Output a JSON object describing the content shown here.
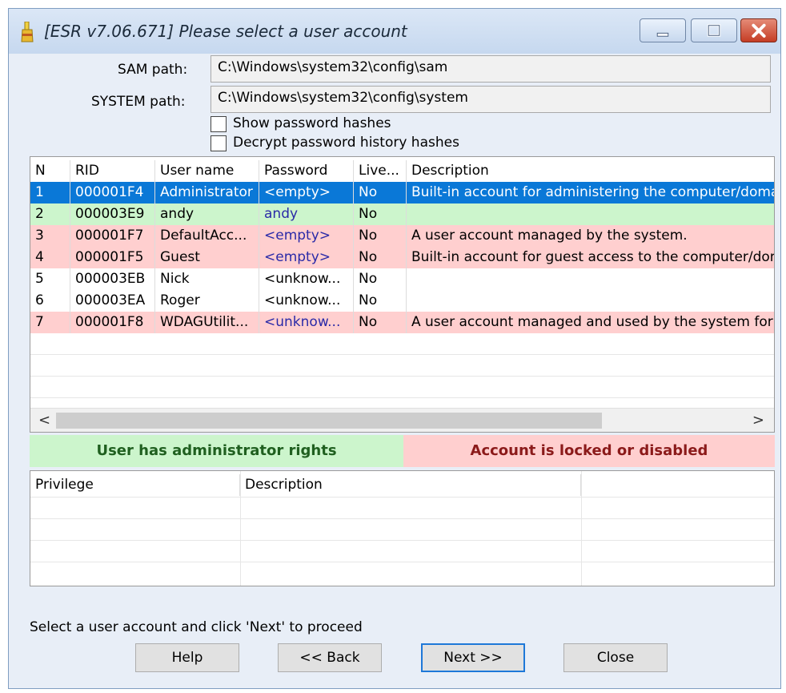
{
  "window": {
    "title": "[ESR v7.06.671]  Please select a user account",
    "icon": "brush-icon"
  },
  "paths": {
    "sam_label": "SAM path:",
    "sam_value": "C:\\Windows\\system32\\config\\sam",
    "system_label": "SYSTEM path:",
    "system_value": "C:\\Windows\\system32\\config\\system"
  },
  "options": {
    "show_hashes": "Show password hashes",
    "decrypt_history": "Decrypt password history hashes"
  },
  "accounts": {
    "columns": [
      "N",
      "RID",
      "User name",
      "Password",
      "Live...",
      "Description"
    ],
    "rows": [
      {
        "n": "1",
        "rid": "000001F4",
        "user": "Administrator",
        "password": "<empty>",
        "live": "No",
        "desc": "Built-in account for administering the computer/doma"
      },
      {
        "n": "2",
        "rid": "000003E9",
        "user": "andy",
        "password": "andy",
        "live": "No",
        "desc": ""
      },
      {
        "n": "3",
        "rid": "000001F7",
        "user": "DefaultAcc...",
        "password": "<empty>",
        "live": "No",
        "desc": "A user account managed by the system."
      },
      {
        "n": "4",
        "rid": "000001F5",
        "user": "Guest",
        "password": "<empty>",
        "live": "No",
        "desc": "Built-in account for guest access to the computer/dom"
      },
      {
        "n": "5",
        "rid": "000003EB",
        "user": "Nick",
        "password": "<unknow...",
        "live": "No",
        "desc": ""
      },
      {
        "n": "6",
        "rid": "000003EA",
        "user": "Roger",
        "password": "<unknow...",
        "live": "No",
        "desc": ""
      },
      {
        "n": "7",
        "rid": "000001F8",
        "user": "WDAGUtilit...",
        "password": "<unknow...",
        "live": "No",
        "desc": "A user account managed and used by the system for V"
      }
    ],
    "row_states": [
      "selected",
      "green",
      "red",
      "red",
      "none",
      "none",
      "red"
    ],
    "scroll_left": "<",
    "scroll_right": ">"
  },
  "legend": {
    "admin": "User has administrator rights",
    "locked": "Account is locked or disabled",
    "admin_color": "#ccf5cc",
    "locked_color": "#ffcfcf",
    "admin_text_color": "#1f5f1f",
    "locked_text_color": "#8b1a1a"
  },
  "privileges": {
    "columns": [
      "Privilege",
      "Description"
    ]
  },
  "status": "Select a user account and click 'Next' to proceed",
  "buttons": {
    "help": "Help",
    "back": "<< Back",
    "next": "Next >>",
    "close": "Close"
  },
  "colors": {
    "selected": "#0a78d7",
    "green": "#ccf5cc",
    "red": "#ffcfcf"
  }
}
